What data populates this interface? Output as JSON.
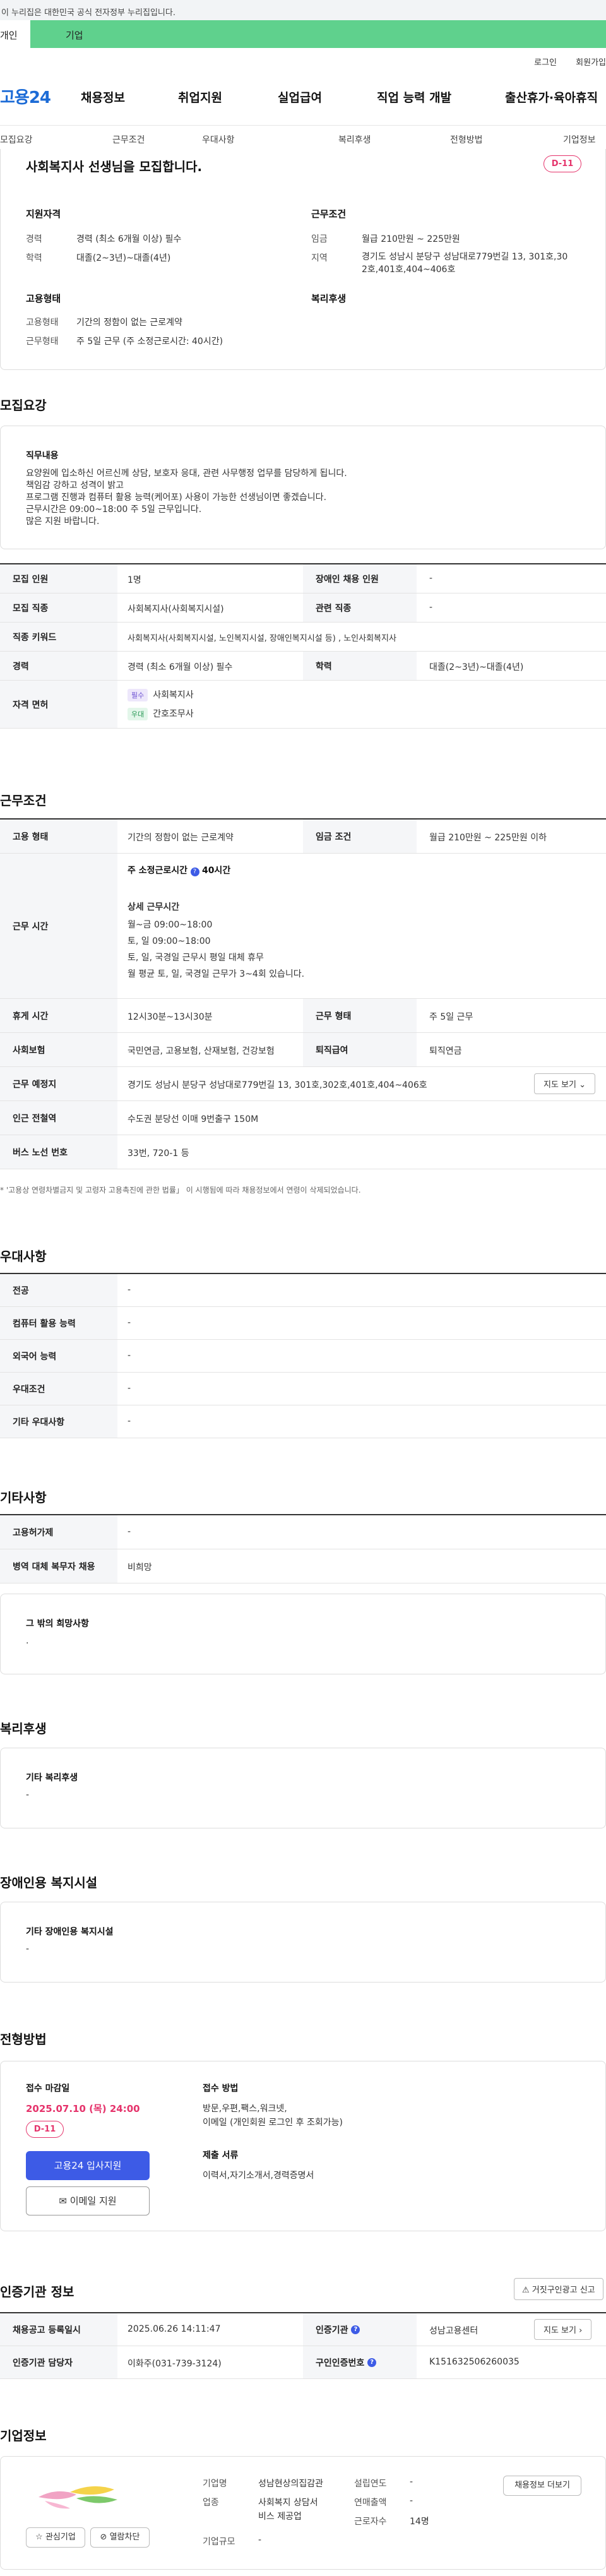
{
  "banner": {
    "text": "이 누리집은 대한민국 공식 전자정부 누리집입니다."
  },
  "top_tabs": {
    "individual": "개인",
    "business": "기업"
  },
  "util": {
    "login": "로그인",
    "signup": "회원가입"
  },
  "logo": "고용24",
  "gnb": [
    "채용정보",
    "취업지원",
    "실업급여",
    "직업 능력 개발",
    "출산휴가·육아휴직"
  ],
  "subnav": [
    "모집요강",
    "근무조건",
    "우대사항",
    "복리후생",
    "전형방법",
    "기업정보"
  ],
  "job": {
    "title": "사회복지사 선생님을 모집합니다.",
    "dday": "D-11",
    "qual_heading": "지원자격",
    "cond_heading": "근무조건",
    "career_label": "경력",
    "career": "경력 (최소 6개월 이상) 필수",
    "edu_label": "학력",
    "edu": "대졸(2~3년)~대졸(4년)",
    "wage_label": "임금",
    "wage": "월급 210만원 ~ 225만원",
    "region_label": "지역",
    "region_1": "경기도 성남시 분당구 성남대로779번길 13, 301호,30",
    "region_2": "2호,401호,404~406호",
    "emp_heading": "고용형태",
    "welfare_heading": "복리후생",
    "emp_type_label": "고용형태",
    "emp_type": "기간의 정함이 없는 근로계약",
    "work_type_label": "근무형태",
    "work_type": "주 5일 근무 (주 소정근로시간: 40시간)"
  },
  "recruit": {
    "heading": "모집요강",
    "duty_heading": "직무내용",
    "duty_lines": [
      "요양원에 입소하신 어르신께 상담, 보호자 응대, 관련 사무행정 업무를 담당하게 됩니다.",
      "책임감 강하고 성격이 밝고",
      "프로그램 진행과 컴퓨터 활용 능력(케어포) 사용이 가능한 선생님이면 좋겠습니다.",
      "근무시간은 09:00~18:00 주 5일 근무입니다.",
      "많은 지원 바랍니다."
    ],
    "rows": {
      "headcount_label": "모집 인원",
      "headcount": "1명",
      "disabled_label": "장애인 채용 인원",
      "disabled": "-",
      "job_label": "모집 직종",
      "job": "사회복지사(사회복지시설)",
      "related_label": "관련 직종",
      "related": "-",
      "keyword_label": "직종 키워드",
      "keyword": "사회복지사(사회복지시설, 노인복지시설, 장애인복지시설 등) , 노인사회복지사",
      "career_label": "경력",
      "career": "경력 (최소 6개월 이상) 필수",
      "edu_label": "학력",
      "edu": "대졸(2~3년)~대졸(4년)",
      "license_label": "자격 면허",
      "license_tag1": "필수",
      "license_1": "사회복지사",
      "license_tag2": "우대",
      "license_2": "간호조무사"
    }
  },
  "conditions": {
    "heading": "근무조건",
    "emp_label": "고용 형태",
    "emp": "기간의 정함이 없는 근로계약",
    "wage_label": "임금 조건",
    "wage": "월급 210만원 ~ 225만원 이하",
    "hours_label": "근무 시간",
    "weekly_label": "주 소정근로시간",
    "weekly": "40시간",
    "detail_heading": "상세 근무시간",
    "detail_lines": [
      "월~금 09:00~18:00",
      "토, 일 09:00~18:00",
      "토, 일, 국경일 근무시 평일 대체 휴무",
      "월 평균 토, 일, 국경일 근무가 3~4회 있습니다."
    ],
    "break_label": "휴게 시간",
    "break": "12시30분~13시30분",
    "worktype_label": "근무 형태",
    "worktype": "주 5일 근무",
    "insurance_label": "사회보험",
    "insurance": "국민연금, 고용보험, 산재보험, 건강보험",
    "retire_label": "퇴직급여",
    "retire": "퇴직연금",
    "place_label": "근무 예정지",
    "place": "경기도 성남시 분당구 성남대로779번길 13, 301호,302호,401호,404~406호",
    "map_btn": "지도 보기",
    "subway_label": "인근 전철역",
    "subway": "수도권 분당선 이매 9번출구 150M",
    "bus_label": "버스 노선 번호",
    "bus": "33번, 720-1 등",
    "note": "* '고용상 연령차별금지 및 고령자 고용촉진에 관한 법률」 이 시행됨에 따라 채용정보에서 연령이 삭제되었습니다."
  },
  "preference": {
    "heading": "우대사항",
    "rows": [
      {
        "label": "전공",
        "value": "-"
      },
      {
        "label": "컴퓨터 활용 능력",
        "value": "-"
      },
      {
        "label": "외국어 능력",
        "value": "-"
      },
      {
        "label": "우대조건",
        "value": "-"
      },
      {
        "label": "기타 우대사항",
        "value": "-"
      }
    ]
  },
  "other": {
    "heading": "기타사항",
    "rows": [
      {
        "label": "고용허가제",
        "value": "-"
      },
      {
        "label": "병역 대체 복무자 채용",
        "value": "비희망"
      }
    ],
    "wish_heading": "그 밖의 희망사항",
    "wish_value": "."
  },
  "welfare": {
    "heading": "복리후생",
    "box_heading": "기타 복리후생",
    "value": "-"
  },
  "disabled_fac": {
    "heading": "장애인용 복지시설",
    "box_heading": "기타 장애인용 복지시설",
    "value": "-"
  },
  "selection": {
    "heading": "전형방법",
    "deadline_label": "접수 마감일",
    "deadline": "2025.07.10 (목) 24:00",
    "dday": "D-11",
    "apply_btn": "고용24 입사지원",
    "email_btn": "이메일 지원",
    "method_label": "접수 방법",
    "method_1": "방문,우편,팩스,워크넷,",
    "method_2": "이메일 (개인회원 로그인 후 조회가능)",
    "docs_label": "제출 서류",
    "docs": "이력서,자기소개서,경력증명서"
  },
  "cert": {
    "heading": "인증기관 정보",
    "report_btn": "거짓구인광고 신고",
    "reg_label": "채용공고 등록일시",
    "reg": "2025.06.26 14:11:47",
    "org_label": "인증기관",
    "org": "성남고용센터",
    "map_btn": "지도 보기",
    "manager_label": "인증기관 담당자",
    "manager": "이화주(031-739-3124)",
    "reqno_label": "구인인증번호",
    "reqno": "K151632506260035"
  },
  "company": {
    "heading": "기업정보",
    "interest_btn": "관심기업",
    "block_btn": "열람차단",
    "name_label": "기업명",
    "name": "성남현상의집감관",
    "industry_label": "업종",
    "industry_1": "사회복지 상담서",
    "industry_2": "비스 제공업",
    "size_label": "기업규모",
    "size": "-",
    "founded_label": "설립연도",
    "founded": "-",
    "sales_label": "연매출액",
    "sales": "-",
    "employees_label": "근로자수",
    "employees": "14명",
    "jobs_btn": "채용정보 더보기"
  },
  "colors": {
    "accent": "#3d5be6",
    "green": "#5fd18d",
    "dday": "#e5336b",
    "deadline": "#e5336b"
  }
}
